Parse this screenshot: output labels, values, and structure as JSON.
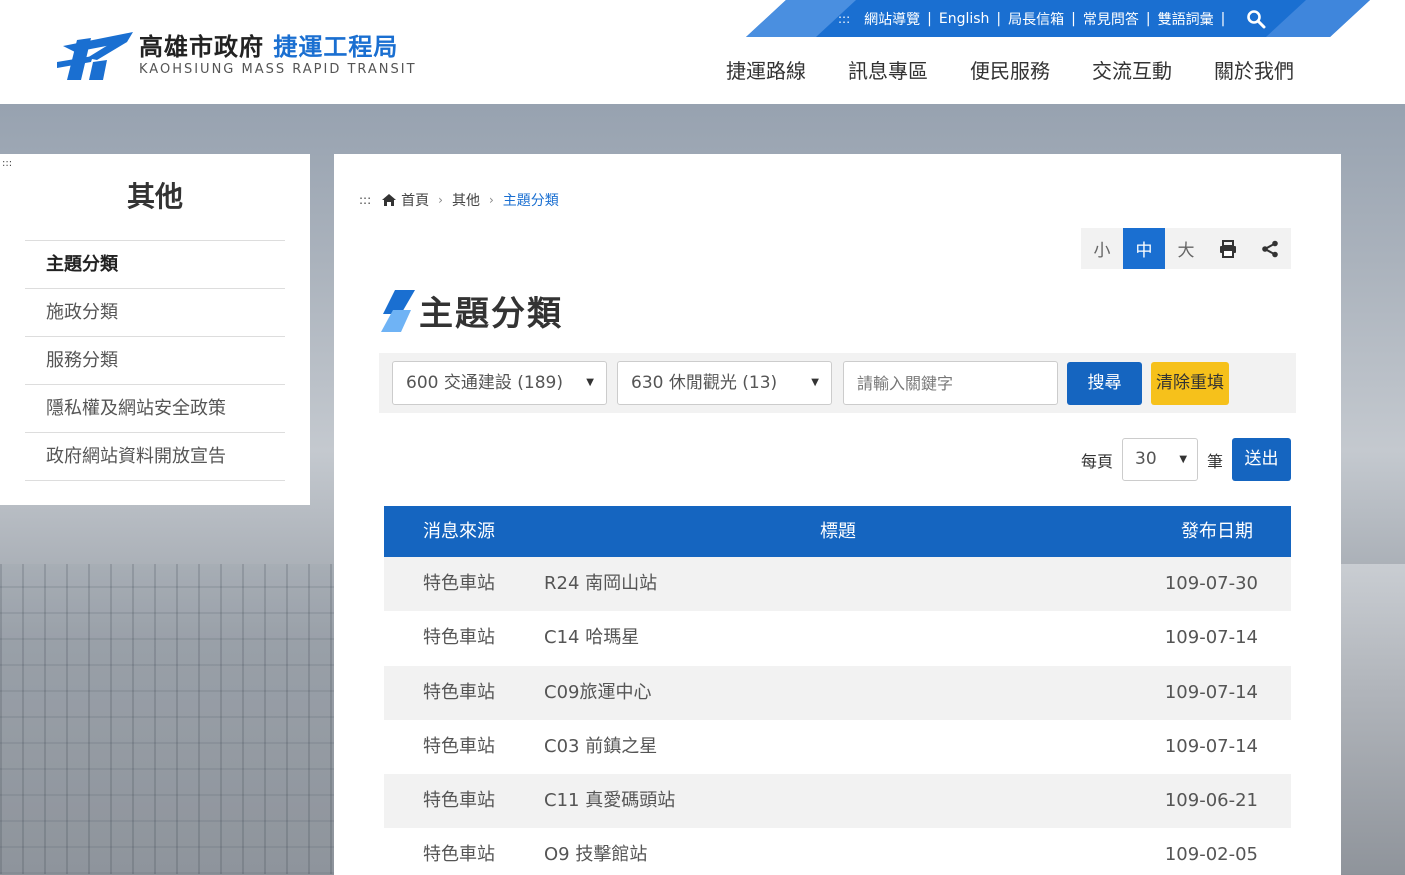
{
  "header": {
    "logo_cn_a": "高雄市政府",
    "logo_cn_b": "捷運工程局",
    "logo_en": "KAOHSIUNG MASS RAPID TRANSIT",
    "top_links": [
      "網站導覽",
      "English",
      "局長信箱",
      "常見問答",
      "雙語詞彙"
    ],
    "nav": [
      "捷運路線",
      "訊息專區",
      "便民服務",
      "交流互動",
      "關於我們"
    ],
    "accent_color": "#1a6fd1"
  },
  "sidebar": {
    "title": "其他",
    "items": [
      {
        "label": "主題分類"
      },
      {
        "label": "施政分類"
      },
      {
        "label": "服務分類"
      },
      {
        "label": "隱私權及網站安全政策"
      },
      {
        "label": "政府網站資料開放宣告"
      }
    ],
    "active_index": 0
  },
  "breadcrumb": {
    "home": "首頁",
    "level1": "其他",
    "current": "主題分類"
  },
  "tools": {
    "small": "小",
    "medium": "中",
    "large": "大",
    "active": "中"
  },
  "page": {
    "title": "主題分類"
  },
  "filter": {
    "category_selected": "600 交通建設 (189)",
    "subcategory_selected": "630 休閒觀光 (13)",
    "keyword_placeholder": "請輸入關鍵字",
    "keyword_value": "",
    "search_label": "搜尋",
    "clear_label": "清除重填"
  },
  "pagination": {
    "per_page_label": "每頁",
    "per_page_value": "30",
    "unit_label": "筆",
    "submit_label": "送出"
  },
  "table": {
    "headers": {
      "source": "消息來源",
      "title": "標題",
      "date": "發布日期"
    },
    "rows": [
      {
        "source": "特色車站",
        "title": "R24 南岡山站",
        "date": "109-07-30"
      },
      {
        "source": "特色車站",
        "title": "C14 哈瑪星",
        "date": "109-07-14"
      },
      {
        "source": "特色車站",
        "title": "C09旅運中心",
        "date": "109-07-14"
      },
      {
        "source": "特色車站",
        "title": "C03 前鎮之星",
        "date": "109-07-14"
      },
      {
        "source": "特色車站",
        "title": "C11 真愛碼頭站",
        "date": "109-06-21"
      },
      {
        "source": "特色車站",
        "title": "O9 技擊館站",
        "date": "109-02-05"
      }
    ]
  }
}
